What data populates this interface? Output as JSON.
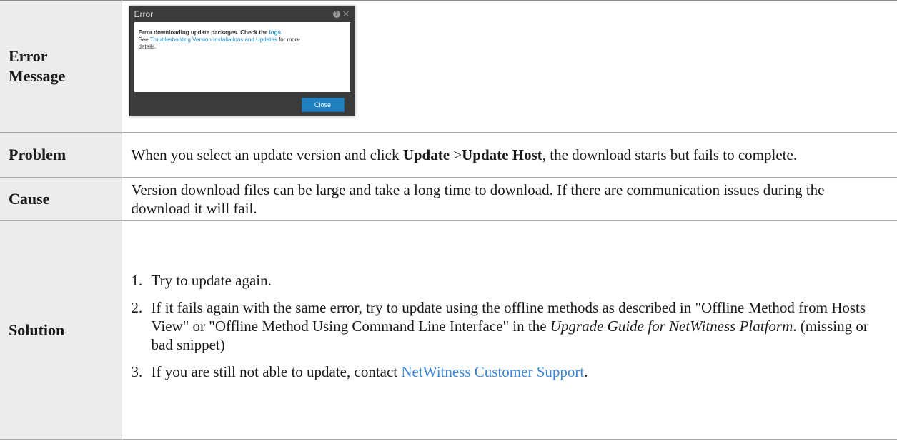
{
  "rows": {
    "error": {
      "label_line1": "Error",
      "label_line2": "Message",
      "dialog": {
        "title": "Error",
        "msg_bold": "Error downloading update packages. Check the ",
        "msg_logs_link": "logs",
        "msg_period": ".",
        "see": "See ",
        "see_link": "Troubleshooting Version Installations and Updates",
        "see_rest_a": " for more",
        "see_rest_b": "details.",
        "close_button": "Close",
        "icons": [
          "help-icon",
          "close-icon"
        ]
      }
    },
    "problem": {
      "label": "Problem",
      "text_a": "When you select an update version and click ",
      "bold_a": "Update",
      "text_b": " >",
      "bold_b": "Update Host",
      "text_c": ", the download starts but fails to complete."
    },
    "cause": {
      "label": "Cause",
      "text": "Version download files can be large and take a long time to download. If there are communication issues during the download it will fail."
    },
    "solution": {
      "label": "Solution",
      "steps": [
        {
          "num": "1.",
          "text": "Try to update again."
        },
        {
          "num": "2.",
          "text_a": "If it fails again with the same error, try to update using the offline methods as described in \"Offline Method from Hosts View\" or \"Offline Method Using Command Line Interface\" in the ",
          "italic": "Upgrade Guide for NetWitness Platform",
          "text_b": ". (missing or bad snippet)"
        },
        {
          "num": "3.",
          "text_a": "If you are still not able to update, contact ",
          "link": "NetWitness Customer Support",
          "text_b": "."
        }
      ]
    }
  },
  "colors": {
    "label_bg": "#ececec",
    "link": "#3a86d6",
    "dialog_bg": "#3b3b3b",
    "dialog_button": "#1f7fbf"
  }
}
